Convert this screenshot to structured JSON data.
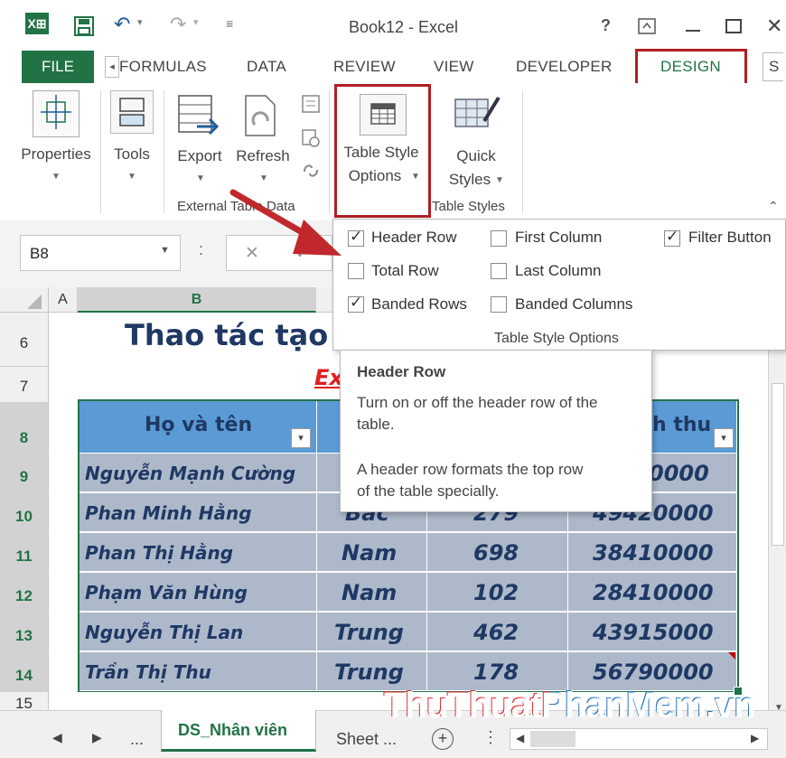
{
  "window": {
    "title": "Book12 - Excel",
    "help_glyph": "?",
    "icons": [
      "excel-logo-icon",
      "save-icon",
      "undo-icon",
      "redo-icon",
      "customize-icon",
      "ribbon-display-icon",
      "minimize-icon",
      "maximize-icon",
      "close-icon"
    ]
  },
  "tabs": {
    "file": "FILE",
    "formulas": "FORMULAS",
    "data": "DATA",
    "review": "REVIEW",
    "view": "VIEW",
    "developer": "DEVELOPER",
    "design": "DESIGN",
    "partial": "S"
  },
  "ribbon": {
    "properties": "Properties",
    "tools": "Tools",
    "export": "Export",
    "refresh": "Refresh",
    "table_style_line1": "Table Style",
    "table_style_line2": "Options",
    "quick_line1": "Quick",
    "quick_line2": "Styles",
    "group_external": "External Table Data",
    "group_table_styles": "Table Styles"
  },
  "formula_bar": {
    "name_box": "B8",
    "cancel": "✕",
    "colon": ":"
  },
  "table_style_options": {
    "group_label": "Table Style Options",
    "options": [
      {
        "label": "Header Row",
        "checked": true
      },
      {
        "label": "First Column",
        "checked": false
      },
      {
        "label": "Filter Button",
        "checked": true
      },
      {
        "label": "Total Row",
        "checked": false
      },
      {
        "label": "Last Column",
        "checked": false
      },
      {
        "label": "Banded Rows",
        "checked": true
      },
      {
        "label": "Banded Columns",
        "checked": false
      }
    ]
  },
  "tooltip": {
    "title": "Header Row",
    "line1": "Turn on or off the header row of the",
    "line2": "table.",
    "line3": "A header row formats the top row",
    "line4": "of the table specially."
  },
  "sheet": {
    "col_headers": [
      "A",
      "B"
    ],
    "row_numbers": [
      "6",
      "7",
      "8",
      "9",
      "10",
      "11",
      "12",
      "13",
      "14",
      "15"
    ],
    "title_text": "Thao tác tạo",
    "subtitle_text": "Ex",
    "header_name": "Họ và tên",
    "header_partial": "h thu",
    "rows": [
      {
        "name": "Nguyễn  Mạnh Cường",
        "c2": "",
        "c3": "",
        "c4": "0000"
      },
      {
        "name": "Phan  Minh Hằng",
        "c2": "Bắc",
        "c3": "279",
        "c4": "49420000"
      },
      {
        "name": "Phan  Thị Hằng",
        "c2": "Nam",
        "c3": "698",
        "c4": "38410000"
      },
      {
        "name": "Phạm  Văn Hùng",
        "c2": "Nam",
        "c3": "102",
        "c4": "28410000"
      },
      {
        "name": "Nguyễn  Thị Lan",
        "c2": "Trung",
        "c3": "462",
        "c4": "43915000"
      },
      {
        "name": "Trần  Thị Thu",
        "c2": "Trung",
        "c3": "178",
        "c4": "56790000"
      }
    ]
  },
  "sheet_tabs": {
    "ellipsis": "...",
    "active": "DS_Nhân viên",
    "other": "Sheet ...",
    "add": "+"
  },
  "watermark": "ThuThuatPhanMem.vn",
  "colors": {
    "excel_green": "#217346",
    "table_header": "#5b9bd5",
    "table_row": "#adb9ca",
    "highlight_red": "#b01f24",
    "watermark_red": "#e8262b",
    "watermark_blue": "#1e73be"
  }
}
